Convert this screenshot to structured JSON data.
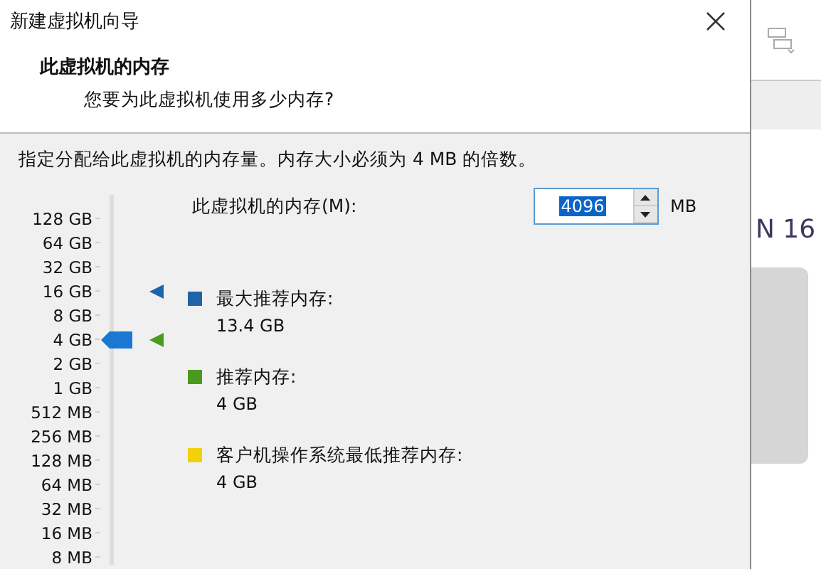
{
  "dialog": {
    "title": "新建虚拟机向导",
    "heading": "此虚拟机的内存",
    "subheading": "您要为此虚拟机使用多少内存?",
    "description": "指定分配给此虚拟机的内存量。内存大小必须为 4 MB 的倍数。"
  },
  "slider": {
    "labels": [
      {
        "text": "128 GB",
        "selected": false
      },
      {
        "text": "64 GB",
        "selected": false
      },
      {
        "text": "32 GB",
        "selected": false
      },
      {
        "text": "16 GB",
        "selected": false,
        "marker": {
          "color": "#1f64a8"
        }
      },
      {
        "text": "8 GB",
        "selected": false
      },
      {
        "text": "4 GB",
        "selected": true,
        "marker": {
          "color": "#4a9a1e"
        }
      },
      {
        "text": "2 GB",
        "selected": false
      },
      {
        "text": "1 GB",
        "selected": false
      },
      {
        "text": "512 MB",
        "selected": false
      },
      {
        "text": "256 MB",
        "selected": false
      },
      {
        "text": "128 MB",
        "selected": false
      },
      {
        "text": "64 MB",
        "selected": false
      },
      {
        "text": "32 MB",
        "selected": false
      },
      {
        "text": "16 MB",
        "selected": false
      },
      {
        "text": "8 MB",
        "selected": false
      }
    ]
  },
  "memory_field": {
    "label": "此虚拟机的内存(M):",
    "value": "4096",
    "unit": "MB"
  },
  "legend": [
    {
      "color": "#1f64a8",
      "label": "最大推荐内存:",
      "value": "13.4 GB"
    },
    {
      "color": "#4a9a1e",
      "label": "推荐内存:",
      "value": "4 GB"
    },
    {
      "color": "#f2d00a",
      "label": "客户机操作系统最低推荐内存:",
      "value": "4 GB"
    }
  ],
  "background_app": {
    "heading": "N 16"
  }
}
